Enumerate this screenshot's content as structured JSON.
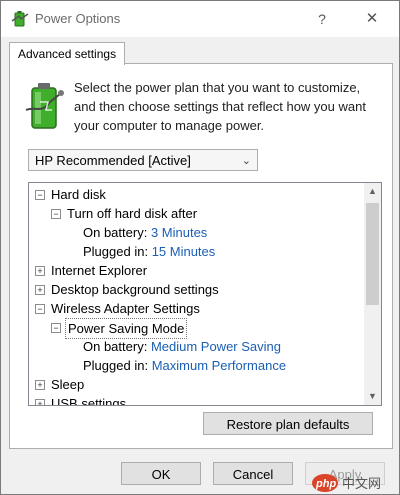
{
  "window": {
    "title": "Power Options",
    "help_label": "?",
    "close_label": "✕"
  },
  "tab": {
    "label": "Advanced settings"
  },
  "description": "Select the power plan that you want to customize, and then choose settings that reflect how you want your computer to manage power.",
  "plan_select": {
    "selected": "HP Recommended [Active]"
  },
  "tree": {
    "hard_disk": "Hard disk",
    "turn_off": "Turn off hard disk after",
    "on_battery_label": "On battery:",
    "on_battery_value_1": "3 Minutes",
    "plugged_in_label": "Plugged in:",
    "plugged_in_value_1": "15 Minutes",
    "internet_explorer": "Internet Explorer",
    "desktop_background": "Desktop background settings",
    "wireless_adapter": "Wireless Adapter Settings",
    "power_saving_mode": "Power Saving Mode",
    "on_battery_value_2": "Medium Power Saving",
    "plugged_in_value_2": "Maximum Performance",
    "sleep": "Sleep",
    "usb_settings": "USB settings"
  },
  "buttons": {
    "restore": "Restore plan defaults",
    "ok": "OK",
    "cancel": "Cancel",
    "apply": "Apply"
  },
  "watermark": {
    "text": "php 中文网"
  },
  "colors": {
    "link": "#1a5fb4",
    "accent_green": "#3fae2a"
  }
}
